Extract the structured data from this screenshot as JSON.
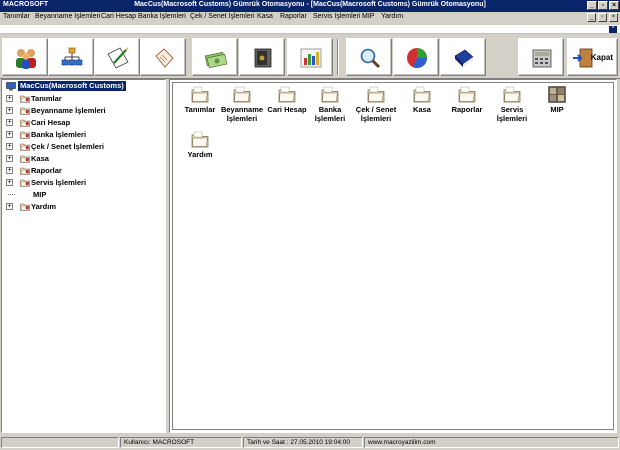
{
  "titlebar": {
    "app_name": "MACROSOFT",
    "title": "MacCus(Macrosoft Customs) Gümrük Otomasyonu - [MacCus(Macrosoft Customs) Gümrük Otomasyonu]"
  },
  "menu": [
    "Tanımlar",
    "Beyanname İşlemleri",
    "Cari Hesap",
    "Banka İşlemleri",
    "Çek / Senet İşlemleri",
    "Kasa",
    "Raporlar",
    "Servis İşlemleri",
    "MIP",
    "Yardım"
  ],
  "toolbar": {
    "close_label": "Kapat",
    "tools": [
      "users-icon",
      "org-chart-icon",
      "notepad-pencil-icon",
      "clipboard-icon",
      "money-icon",
      "safe-icon",
      "bar-chart-icon",
      "magnifier-icon",
      "pie-chart-icon",
      "book-icon",
      "calculator-icon",
      "exit-door-icon"
    ]
  },
  "tree": {
    "root": "MacCus(Macrosoft Customs)",
    "items": [
      {
        "label": "Tanımlar",
        "expandable": true
      },
      {
        "label": "Beyanname İşlemleri",
        "expandable": true
      },
      {
        "label": "Cari Hesap",
        "expandable": true
      },
      {
        "label": "Banka İşlemleri",
        "expandable": true
      },
      {
        "label": "Çek / Senet İşlemleri",
        "expandable": true
      },
      {
        "label": "Kasa",
        "expandable": true
      },
      {
        "label": "Raporlar",
        "expandable": true
      },
      {
        "label": "Servis İşlemleri",
        "expandable": true
      },
      {
        "label": "MIP",
        "expandable": false
      },
      {
        "label": "Yardım",
        "expandable": true
      }
    ]
  },
  "content": {
    "items": [
      {
        "line1": "Tanımlar",
        "line2": ""
      },
      {
        "line1": "Beyanname",
        "line2": "İşlemleri"
      },
      {
        "line1": "Cari Hesap",
        "line2": ""
      },
      {
        "line1": "Banka",
        "line2": "İşlemleri"
      },
      {
        "line1": "Çek / Senet",
        "line2": "İşlemleri"
      },
      {
        "line1": "Kasa",
        "line2": ""
      },
      {
        "line1": "Raporlar",
        "line2": ""
      },
      {
        "line1": "Servis",
        "line2": "İşlemleri"
      },
      {
        "line1": "MIP",
        "line2": ""
      },
      {
        "line1": "Yardım",
        "line2": ""
      }
    ]
  },
  "status": {
    "user": "Kullanıcı: MACROSOFT",
    "datetime": "Tarih ve Saat : 27.05.2010 19:04:00",
    "website": "www.macroyazilim.com"
  },
  "colors": {
    "titlebar": "#0a246a",
    "selection": "#0a246a",
    "face": "#d4d0c8"
  }
}
